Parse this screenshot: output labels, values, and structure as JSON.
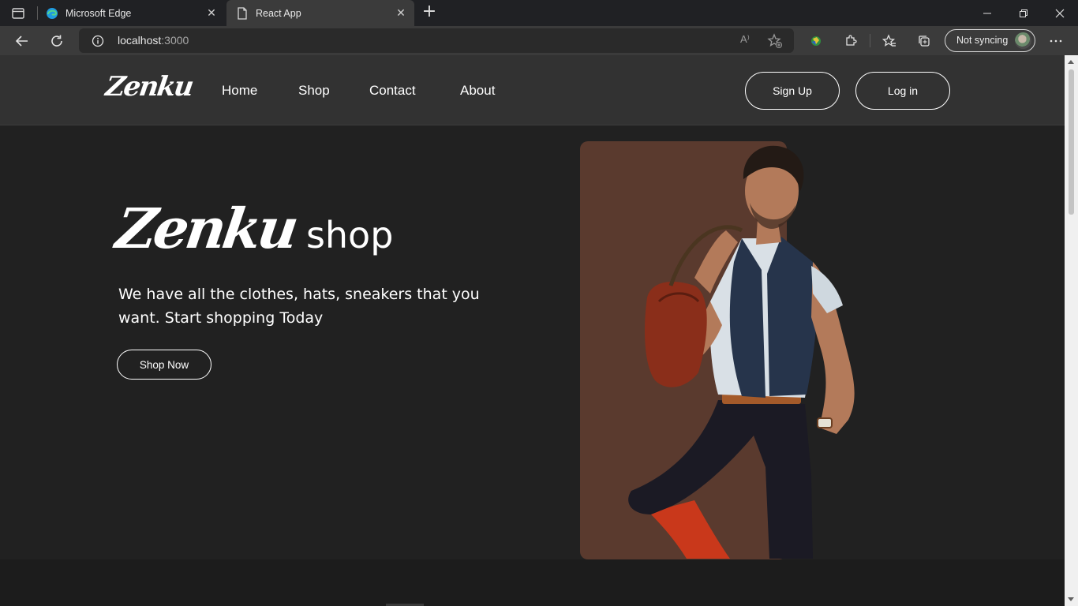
{
  "browser": {
    "tabs": [
      {
        "title": "Microsoft Edge",
        "icon": "edge-icon"
      },
      {
        "title": "React App",
        "icon": "page-icon",
        "active": true
      }
    ],
    "url_host": "localhost",
    "url_port": ":3000",
    "read_aloud": "A⁾",
    "sync_label": "Not syncing"
  },
  "site": {
    "logo": "Zenku",
    "nav": [
      "Home",
      "Shop",
      "Contact",
      "About"
    ],
    "signup": "Sign Up",
    "login": "Log in"
  },
  "hero": {
    "title_script": "Zenku",
    "title_word": "shop",
    "text": "We have all the clothes, hats, sneakers that you want. Start shopping Today",
    "button": "Shop Now",
    "card_color": "#5a3a2e"
  }
}
